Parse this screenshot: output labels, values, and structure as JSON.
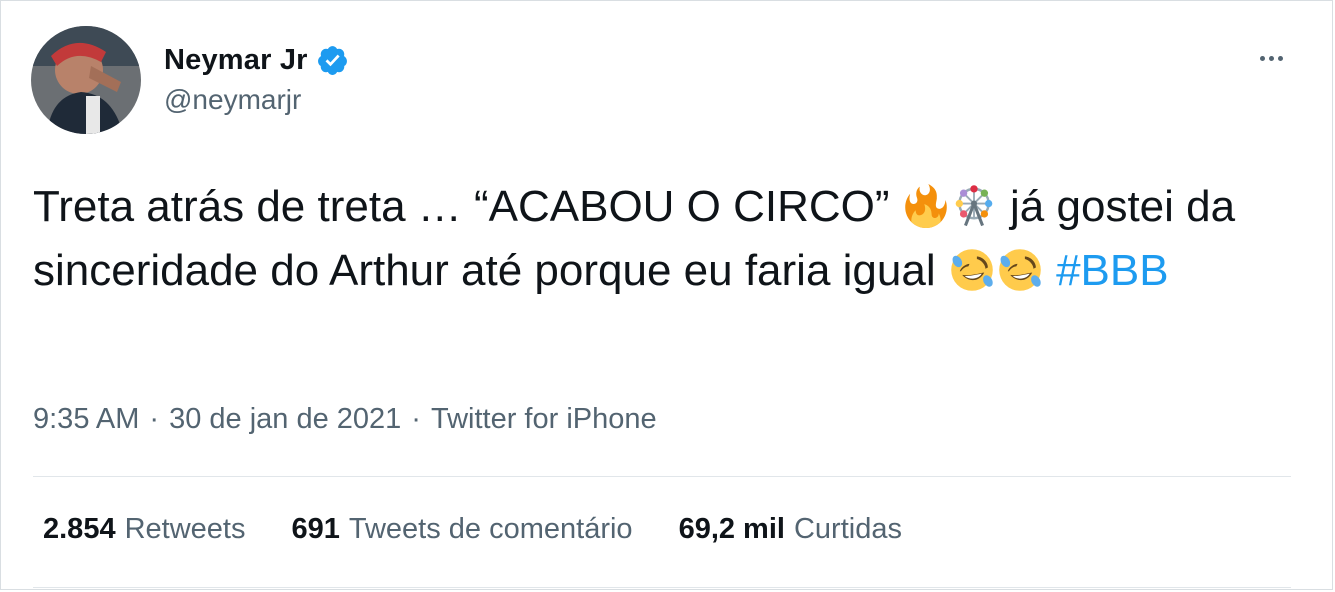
{
  "author": {
    "display_name": "Neymar Jr",
    "handle": "@neymarjr",
    "verified": true
  },
  "tweet": {
    "part1": "Treta atrás de treta … “ACABOU O CIRCO”",
    "emoji1": "fire-emoji",
    "emoji2": "ferris-wheel-emoji",
    "part2": "já gostei da sinceridade do Arthur até porque eu faria igual",
    "emoji3": "rolling-on-floor-laughing-emoji",
    "emoji4": "rolling-on-floor-laughing-emoji",
    "hashtag": "#BBB"
  },
  "meta": {
    "time": "9:35 AM",
    "date": "30 de jan de 2021",
    "separator": "·",
    "source": "Twitter for iPhone"
  },
  "stats": {
    "retweets_count": "2.854",
    "retweets_label": "Retweets",
    "quotes_count": "691",
    "quotes_label": "Tweets de comentário",
    "likes_count": "69,2 mil",
    "likes_label": "Curtidas"
  },
  "colors": {
    "accent": "#1d9bf0",
    "secondary_text": "#536471",
    "primary_text": "#0f1419",
    "divider": "#e1e6ea"
  }
}
